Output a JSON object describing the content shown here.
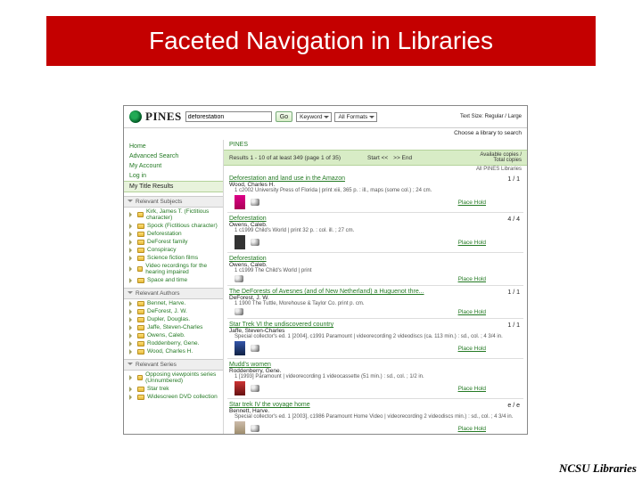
{
  "slide": {
    "title": "Faceted Navigation in Libraries",
    "footer": "NCSU Libraries"
  },
  "header": {
    "brand": "PINES",
    "search_value": "deforestation",
    "go": "Go",
    "sel_field": "Keyword",
    "sel_format": "All Formats",
    "text_size_label": "Text Size: Regular / Large",
    "choose_library": "Choose a library to search"
  },
  "nav": {
    "home": "Home",
    "advanced": "Advanced Search",
    "account": "My Account",
    "login": "Log in",
    "results_tab": "My Title Results"
  },
  "facets": {
    "subjects_head": "Relevant Subjects",
    "subjects": [
      "Kirk, James T. (Fictitious character)",
      "Spock (Fictitious character)",
      "Deforestation",
      "DeForest family",
      "Conspiracy",
      "Science fiction films",
      "Video recordings for the hearing impaired",
      "Space and time"
    ],
    "authors_head": "Relevant Authors",
    "authors": [
      "Bennet, Harve.",
      "DeForest, J. W.",
      "Dupler, Douglas.",
      "Jaffe, Steven-Charles",
      "Owens, Caleb.",
      "Roddenberry, Gene.",
      "Wood, Charles H."
    ],
    "series_head": "Relevant Series",
    "series": [
      "Opposing viewpoints series (Unnumbered)",
      "Star trek",
      "Widescreen DVD collection"
    ]
  },
  "crumb": "PINES",
  "resultbar": {
    "summary": "Results 1 - 10 of at least 349  (page 1 of 35)",
    "start": "Start <<",
    "end": ">> End",
    "avail1": "Available copies /",
    "avail2": "Total copies",
    "scope": "All PINES Libraries"
  },
  "hold": "Place Hold",
  "results": [
    {
      "title": "Deforestation and land use in the Amazon",
      "author": "Wood, Charles H.",
      "pub": "1 c2002 University Press of Florida | print xiii, 365 p. : ill., maps (some col.) ; 24 cm.",
      "num": "1 / 1",
      "thumb": "pink"
    },
    {
      "title": "Deforestation",
      "author": "Owens, Caleb.",
      "pub": "1 c1999 Child's World | print 32 p. : col. ill. ; 27 cm.",
      "num": "4 / 4",
      "thumb": "black"
    },
    {
      "title": "Deforestation",
      "author": "Owens, Caleb.",
      "pub": "1 c1999 The Child's World | print",
      "num": "",
      "thumb": ""
    },
    {
      "title": "The DeForests of Avesnes (and of New Netherland) a Huguenot thre...",
      "author": "DeForest, J. W.",
      "pub": "1 1900 The Tuttle, Morehouse & Taylor Co.  print p. cm.",
      "num": "1 / 1",
      "thumb": ""
    },
    {
      "title": "Star Trek VI the undiscovered country",
      "author": "Jaffe, Steven-Charles",
      "pub": "Special collector's ed. 1 [2004], c1991 Paramount | videorecording 2 videodiscs (ca. 113 min.) : sd., col. ; 4 3/4 in.",
      "num": "1 / 1",
      "thumb": "blue"
    },
    {
      "title": "Mudd's women",
      "author": "Roddenberry, Gene.",
      "pub": "1 [1993] Paramount | videorecording 1 videocassette (51 min.) : sd., col. ; 1/2 in.",
      "num": "",
      "thumb": "red"
    },
    {
      "title": "Star trek IV the voyage home",
      "author": "Bennett, Harve.",
      "pub": "Special collector's ed. 1 [2003], c1986 Paramount Home Video | videorecording 2 videodiscs   min.) : sd., col. ; 4 3/4 in.",
      "num": "e / e",
      "thumb": "tan"
    }
  ]
}
